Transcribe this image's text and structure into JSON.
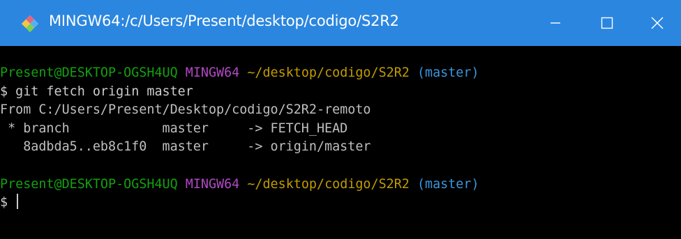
{
  "window": {
    "title": "MINGW64:/c/Users/Present/desktop/codigo/S2R2",
    "app_icon": "mingw-diamond-icon",
    "controls": {
      "minimize_icon": "minimize-icon",
      "maximize_icon": "maximize-icon",
      "close_icon": "close-icon"
    }
  },
  "colors": {
    "titlebar": "#2b86df",
    "background": "#000000",
    "user_host": "#13a10e",
    "shell_name": "#b148c6",
    "path": "#c19c00",
    "branch": "#3a96dd",
    "text": "#bfbfbf"
  },
  "terminal": {
    "prompt1": {
      "user_host": "Present@DESKTOP-OGSH4UQ",
      "shell": "MINGW64",
      "path": "~/desktop/codigo/S2R2",
      "branch": "(master)"
    },
    "command1": "$ git fetch origin master",
    "output": [
      "From C:/Users/Present/Desktop/codigo/S2R2-remoto",
      " * branch            master     -> FETCH_HEAD",
      "   8adbda5..eb8c1f0  master     -> origin/master"
    ],
    "prompt2": {
      "user_host": "Present@DESKTOP-OGSH4UQ",
      "shell": "MINGW64",
      "path": "~/desktop/codigo/S2R2",
      "branch": "(master)"
    },
    "input_prompt": "$ "
  }
}
